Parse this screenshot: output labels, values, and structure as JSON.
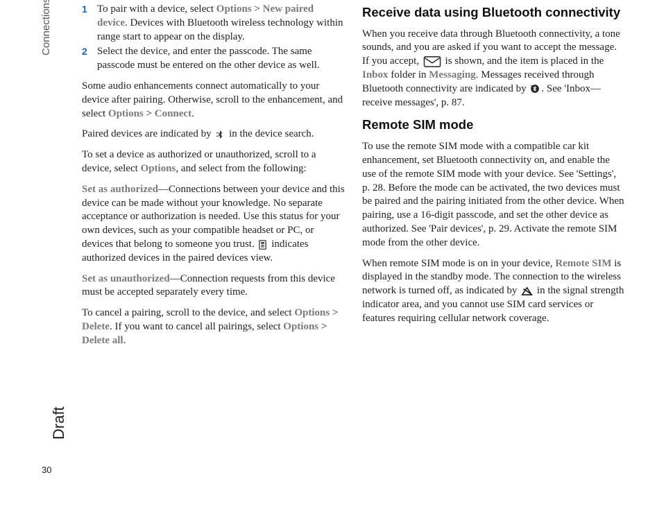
{
  "sidebar": {
    "section": "Connections",
    "draft": "Draft",
    "page": "30"
  },
  "left": {
    "step1_a": "To pair with a device, select ",
    "step1_opt": "Options",
    "step1_gt": " > ",
    "step1_new": "New paired device",
    "step1_b": ". Devices with Bluetooth wireless technology within range start to appear on the display.",
    "step2": "Select the device, and enter the passcode. The same passcode must be entered on the other device as well.",
    "p1_a": "Some audio enhancements connect automatically to your device after pairing. Otherwise, scroll to the enhancement, and select ",
    "p1_opt": "Options",
    "p1_gt": " > ",
    "p1_conn": "Connect",
    "p1_dot": ".",
    "p2_a": "Paired devices are indicated by ",
    "p2_b": " in the device search.",
    "p3_a": "To set a device as authorized or unauthorized, scroll to a device, select ",
    "p3_opt": "Options",
    "p3_b": ", and select from the following:",
    "p4_head": "Set as authorized",
    "p4_body_a": "—Connections between your device and this device can be made without your knowledge. No separate acceptance or authorization is needed. Use this status for your own devices, such as your compatible headset or PC, or devices that belong to someone you trust. ",
    "p4_body_b": " indicates authorized devices in the paired devices view.",
    "p5_head": "Set as unauthorized",
    "p5_body": "—Connection requests from this device must be accepted separately every time.",
    "p6_a": "To cancel a pairing, scroll to the device, and select ",
    "p6_opt1": "Options",
    "p6_gt1": " > ",
    "p6_del": "Delete",
    "p6_b": ". If you want to cancel all pairings, select ",
    "p6_opt2": "Options",
    "p6_gt2": " > ",
    "p6_delall": "Delete all",
    "p6_dot": "."
  },
  "right": {
    "h1": "Receive data using Bluetooth connectivity",
    "p1_a": "When you receive data through Bluetooth connectivity, a tone sounds, and you are asked if you want to accept the message. If you accept, ",
    "p1_b": " is shown, and the item is placed in the ",
    "p1_inbox": "Inbox",
    "p1_c": " folder in ",
    "p1_msg": "Messaging",
    "p1_d": ". Messages received through Bluetooth connectivity are indicated by ",
    "p1_e": ". See 'Inbox—receive messages', p. 87.",
    "h2": "Remote SIM mode",
    "p2": "To use the remote SIM mode with a compatible car kit enhancement, set Bluetooth connectivity on, and enable the use of the remote SIM mode with your device. See 'Settings', p. 28. Before the mode can be activated, the two devices must be paired and the pairing initiated from the other device. When pairing, use a 16-digit passcode, and set the other device as authorized. See 'Pair devices', p. 29. Activate the remote SIM mode from the other device.",
    "p3_a": "When remote SIM mode is on in your device, ",
    "p3_rsim": "Remote SIM",
    "p3_b": " is displayed in the standby mode. The connection to the wireless network is turned off, as indicated by ",
    "p3_c": " in the signal strength indicator area, and you cannot use SIM card services or features requiring cellular network coverage."
  }
}
